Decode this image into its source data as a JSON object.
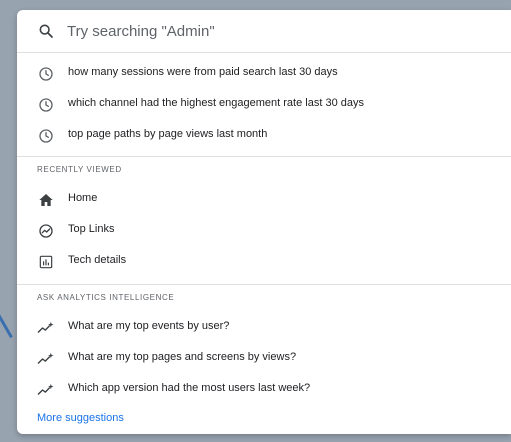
{
  "search": {
    "placeholder": "Try searching \"Admin\"",
    "icon": "search-icon"
  },
  "recent_queries": [
    {
      "label": "how many sessions were from paid search last 30 days",
      "icon": "history-icon"
    },
    {
      "label": "which channel had the highest engagement rate last 30 days",
      "icon": "history-icon"
    },
    {
      "label": "top page paths by page views last month",
      "icon": "history-icon"
    }
  ],
  "recently_viewed": {
    "header": "RECENTLY VIEWED",
    "items": [
      {
        "label": "Home",
        "icon": "home-icon"
      },
      {
        "label": "Top Links",
        "icon": "insights-icon"
      },
      {
        "label": "Tech details",
        "icon": "bar-chart-icon"
      }
    ]
  },
  "analytics_intelligence": {
    "header": "ASK ANALYTICS INTELLIGENCE",
    "items": [
      {
        "label": "What are my top events by user?",
        "icon": "sparkle-trend-icon"
      },
      {
        "label": "What are my top pages and screens by views?",
        "icon": "sparkle-trend-icon"
      },
      {
        "label": "Which app version had the most users last week?",
        "icon": "sparkle-trend-icon"
      }
    ],
    "more_label": "More suggestions"
  },
  "colors": {
    "text": "#202124",
    "muted": "#5f6368",
    "link": "#1a73e8",
    "divider": "#e0e0e0"
  }
}
